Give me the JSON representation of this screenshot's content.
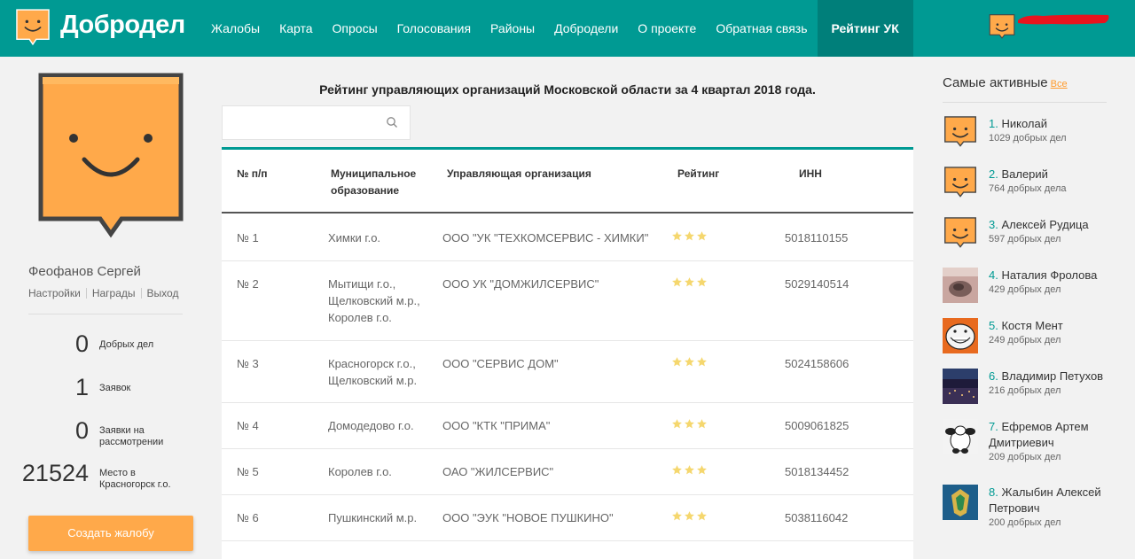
{
  "header": {
    "logo_text": "Добродел",
    "nav": [
      "Жалобы",
      "Карта",
      "Опросы",
      "Голосования",
      "Районы",
      "Добродели",
      "О проекте",
      "Обратная связь",
      "Рейтинг УК"
    ],
    "active_nav": "Рейтинг УК"
  },
  "user": {
    "name": "Феофанов Сергей",
    "links": [
      "Настройки",
      "Награды",
      "Выход"
    ],
    "stats": [
      {
        "value": "0",
        "label": "Добрых дел"
      },
      {
        "value": "1",
        "label": "Заявок"
      },
      {
        "value": "0",
        "label": "Заявки на рассмотрении"
      },
      {
        "value": "21524",
        "label": "Место в Красногорск г.о."
      }
    ],
    "create_button": "Создать жалобу"
  },
  "main": {
    "title": "Рейтинг управляющих организаций Московской области за 4 квартал 2018 года.",
    "search_value": "",
    "columns": [
      "№ п/п",
      "Муниципальное образование",
      "Управляющая организация",
      "Рейтинг",
      "ИНН"
    ],
    "rows": [
      {
        "num": "№ 1",
        "municipality": "Химки г.о.",
        "org": "ООО \"УК \"ТЕХКОМСЕРВИС - ХИМКИ\"",
        "rating": 3,
        "inn": "5018110155"
      },
      {
        "num": "№ 2",
        "municipality": "Мытищи г.о., Щелковский м.р., Королев г.о.",
        "org": "ООО УК \"ДОМЖИЛСЕРВИС\"",
        "rating": 3,
        "inn": "5029140514"
      },
      {
        "num": "№ 3",
        "municipality": "Красногорск г.о., Щелковский м.р.",
        "org": "ООО \"СЕРВИС ДОМ\"",
        "rating": 3,
        "inn": "5024158606"
      },
      {
        "num": "№ 4",
        "municipality": "Домодедово г.о.",
        "org": "ООО \"КТК \"ПРИМА\"",
        "rating": 3,
        "inn": "5009061825"
      },
      {
        "num": "№ 5",
        "municipality": "Королев г.о.",
        "org": "ОАО \"ЖИЛСЕРВИС\"",
        "rating": 3,
        "inn": "5018134452"
      },
      {
        "num": "№ 6",
        "municipality": "Пушкинский м.р.",
        "org": "ООО \"ЭУК \"НОВОЕ ПУШКИНО\"",
        "rating": 3,
        "inn": "5038116042"
      }
    ]
  },
  "active": {
    "title": "Самые активные",
    "all_link": "Все",
    "people": [
      {
        "rank": "1.",
        "name": "Николай",
        "count": "1029 добрых дел",
        "avatar": "shield"
      },
      {
        "rank": "2.",
        "name": "Валерий",
        "count": "764 добрых дела",
        "avatar": "shield"
      },
      {
        "rank": "3.",
        "name": "Алексей Рудица",
        "count": "597 добрых дел",
        "avatar": "shield"
      },
      {
        "rank": "4.",
        "name": "Наталия Фролова",
        "count": "429 добрых дел",
        "avatar": "photo-cat"
      },
      {
        "rank": "5.",
        "name": "Костя Мент",
        "count": "249 добрых дел",
        "avatar": "photo-trollface"
      },
      {
        "rank": "6.",
        "name": "Владимир Петухов",
        "count": "216 добрых дел",
        "avatar": "photo-city-night"
      },
      {
        "rank": "7.",
        "name": "Ефремов Артем Дмитриевич",
        "count": "209 добрых дел",
        "avatar": "photo-panda"
      },
      {
        "rank": "8.",
        "name": "Жалыбин Алексей Петрович",
        "count": "200 добрых дел",
        "avatar": "photo-emblem"
      }
    ]
  },
  "colors": {
    "brand": "#009a93",
    "accent": "#ffa94a",
    "star": "#f5d76e"
  }
}
